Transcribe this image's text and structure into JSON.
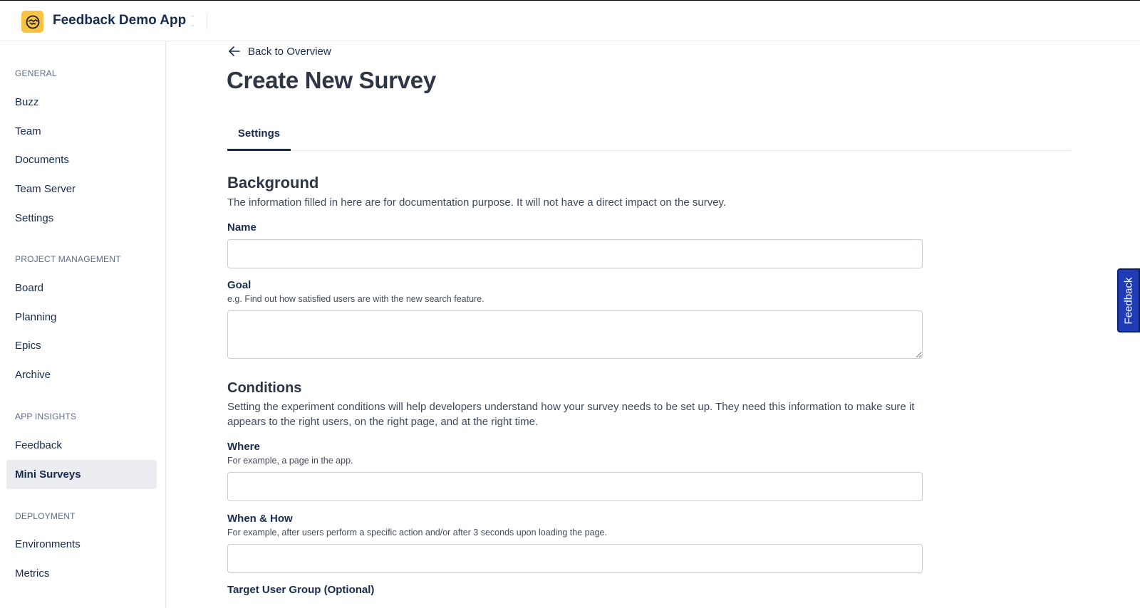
{
  "app": {
    "title": "Feedback Demo App",
    "logo_icon": "handshake-icon",
    "brand_color": "#f6c342"
  },
  "sidebar": {
    "sections": [
      {
        "label": "GENERAL",
        "items": [
          "Buzz",
          "Team",
          "Documents",
          "Team Server",
          "Settings"
        ]
      },
      {
        "label": "PROJECT MANAGEMENT",
        "items": [
          "Board",
          "Planning",
          "Epics",
          "Archive"
        ]
      },
      {
        "label": "APP INSIGHTS",
        "items": [
          "Feedback",
          "Mini Surveys"
        ]
      },
      {
        "label": "DEPLOYMENT",
        "items": [
          "Environments",
          "Metrics"
        ]
      }
    ],
    "active_item": "Mini Surveys"
  },
  "main": {
    "back_label": "Back to Overview",
    "title": "Create New Survey",
    "tabs": [
      {
        "label": "Settings",
        "selected": true
      }
    ],
    "background": {
      "title": "Background",
      "description": "The information filled in here are for documentation purpose. It will not have a direct impact on the survey.",
      "name_label": "Name",
      "name_value": "",
      "goal_label": "Goal",
      "goal_hint": "e.g. Find out how satisfied users are with the new search feature.",
      "goal_value": ""
    },
    "conditions": {
      "title": "Conditions",
      "description": "Setting the experiment conditions will help developers understand how your survey needs to be set up. They need this information to make sure it appears to the right users, on the right page, and at the right time.",
      "where_label": "Where",
      "where_hint": "For example, a page in the app.",
      "where_value": "",
      "when_label": "When & How",
      "when_hint": "For example, after users perform a specific action and/or after 3 seconds upon loading the page.",
      "when_value": "",
      "target_label": "Target User Group (Optional)"
    }
  },
  "feedback_tab": {
    "label": "Feedback",
    "color": "#1f3cb4"
  }
}
